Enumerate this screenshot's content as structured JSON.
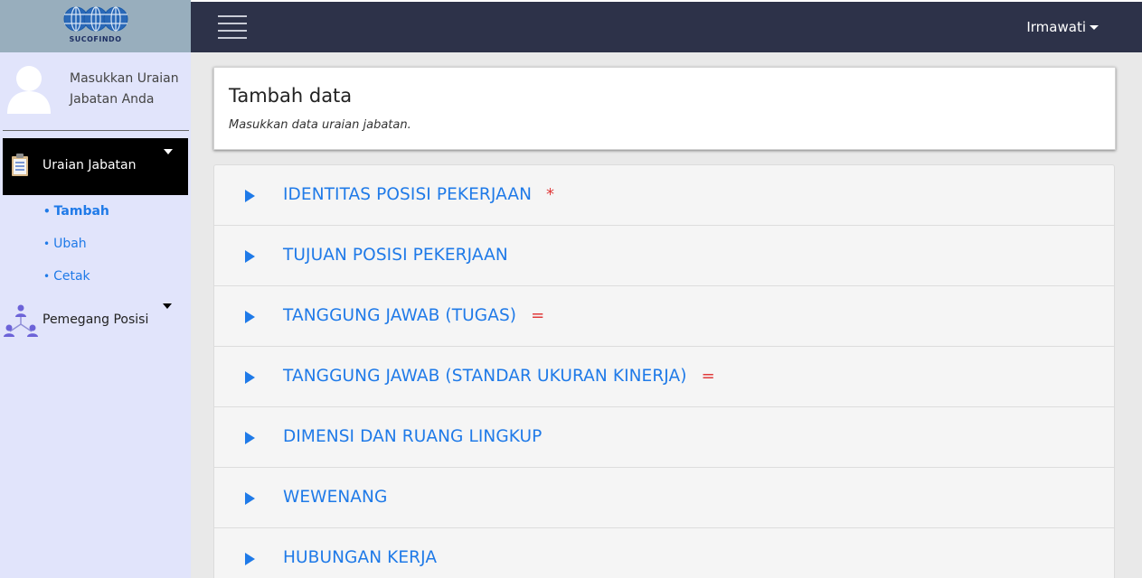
{
  "brand": {
    "logo_text": "SUCOFINDO"
  },
  "topbar": {
    "user_name": "Irmawati"
  },
  "profile": {
    "text": "Masukkan Uraian Jabatan Anda"
  },
  "sidebar": {
    "main_menu": {
      "label": "Uraian Jabatan"
    },
    "submenu": [
      {
        "label": "Tambah"
      },
      {
        "label": "Ubah"
      },
      {
        "label": "Cetak"
      }
    ],
    "second_menu": {
      "label": "Pemegang Posisi"
    }
  },
  "header": {
    "title": "Tambah data",
    "subtitle": "Masukkan data uraian jabatan."
  },
  "accordion": {
    "items": [
      {
        "label": "IDENTITAS POSISI PEKERJAAN",
        "mark": "*"
      },
      {
        "label": "TUJUAN POSISI PEKERJAAN",
        "mark": ""
      },
      {
        "label": "TANGGUNG JAWAB (TUGAS)",
        "mark": "="
      },
      {
        "label": "TANGGUNG JAWAB (STANDAR UKURAN KINERJA)",
        "mark": "="
      },
      {
        "label": "DIMENSI DAN RUANG LINGKUP",
        "mark": ""
      },
      {
        "label": "WEWENANG",
        "mark": ""
      },
      {
        "label": "HUBUNGAN KERJA",
        "mark": ""
      }
    ]
  },
  "colors": {
    "accent": "#1f7ae8",
    "topbar": "#2d3249",
    "sidebar": "#e1e4fb",
    "required": "#e03b3b"
  }
}
